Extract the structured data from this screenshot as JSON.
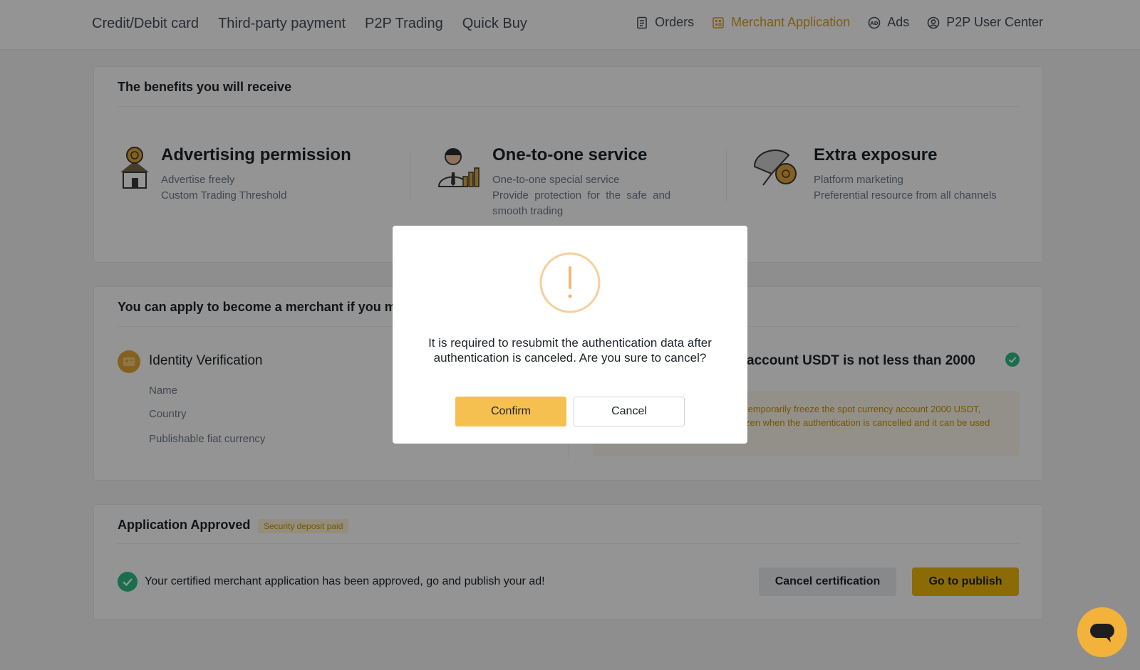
{
  "nav": {
    "left": [
      "Credit/Debit card",
      "Third-party payment",
      "P2P Trading",
      "Quick Buy"
    ],
    "right": [
      {
        "label": "Orders",
        "icon": "orders-icon"
      },
      {
        "label": "Merchant Application",
        "icon": "merchant-application-icon"
      },
      {
        "label": "Ads",
        "icon": "ads-icon"
      },
      {
        "label": "P2P User Center",
        "icon": "user-icon"
      }
    ]
  },
  "benefits": {
    "title": "The benefits you will receive",
    "items": [
      {
        "title": "Advertising permission",
        "lines": [
          "Advertise freely",
          "Custom Trading Threshold"
        ],
        "icon": "advertising-icon"
      },
      {
        "title": "One-to-one service",
        "lines": [
          "One-to-one special service",
          "Provide  protection  for  the  safe  and",
          "smooth trading"
        ],
        "icon": "service-agent-icon"
      },
      {
        "title": "Extra exposure",
        "lines": [
          "Platform marketing",
          "Preferential resource from all channels"
        ],
        "icon": "exposure-icon"
      }
    ]
  },
  "requirements": {
    "title": "You can apply to become a merchant if you m",
    "identity": {
      "title": "Identity Verification",
      "fields": [
        "Name",
        "Country",
        "Publishable fiat currency"
      ]
    },
    "account": {
      "title": "account USDT is not less than 2000",
      "note_line1": "temporarily freeze the spot currency account 2000 USDT,",
      "note_line2": "zen when the authentication is cancelled and it can be used"
    }
  },
  "approved": {
    "title": "Application Approved",
    "badge": "Security deposit paid",
    "message": "Your certified merchant application has been approved, go and publish your ad!",
    "cancel_label": "Cancel certification",
    "publish_label": "Go to publish"
  },
  "modal": {
    "message": "It is required to resubmit the authentication data after authentication is canceled. Are you sure to cancel?",
    "confirm_label": "Confirm",
    "cancel_label": "Cancel"
  },
  "colors": {
    "accent": "#F0B90B",
    "success": "#2EBD85",
    "overlay": "rgba(0,0,0,0.42)"
  }
}
